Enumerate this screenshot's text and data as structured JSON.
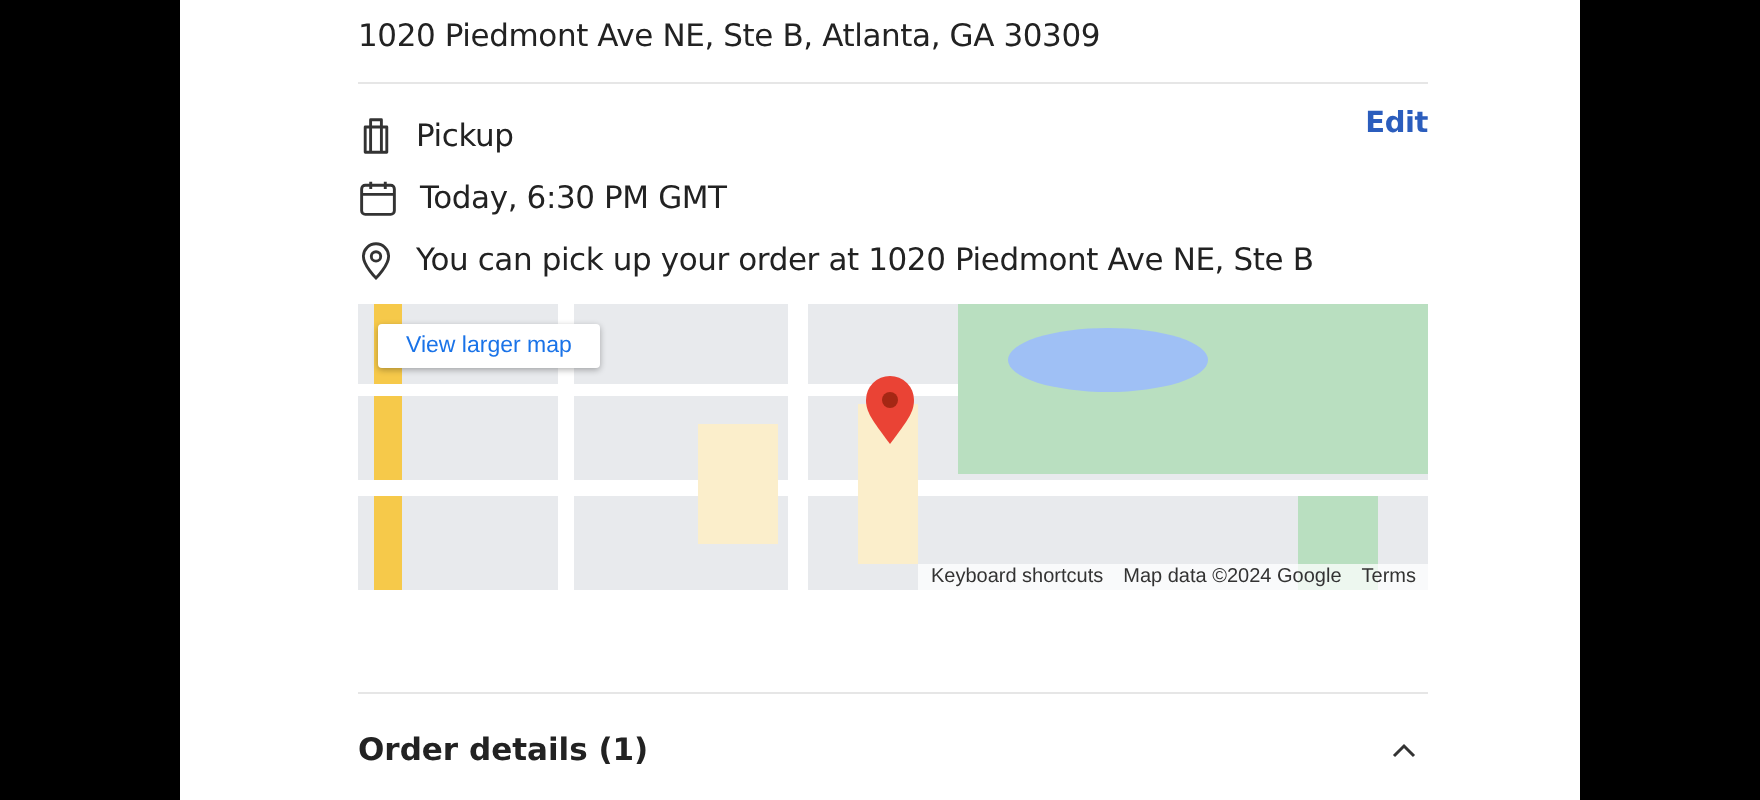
{
  "store": {
    "address": "1020 Piedmont Ave NE, Ste B, Atlanta, GA 30309"
  },
  "fulfillment": {
    "method": "Pickup",
    "edit": "Edit",
    "time": "Today, 6:30 PM GMT",
    "instructions": "You can pick up your order at 1020 Piedmont Ave NE, Ste B"
  },
  "map": {
    "kind": "picture",
    "larger_map": "View larger map",
    "attribution": [
      "Keyboard shortcuts",
      "Map data ©2024 Google",
      "Terms"
    ]
  },
  "order_details": {
    "title": "Order details (1)",
    "expanded": true
  }
}
